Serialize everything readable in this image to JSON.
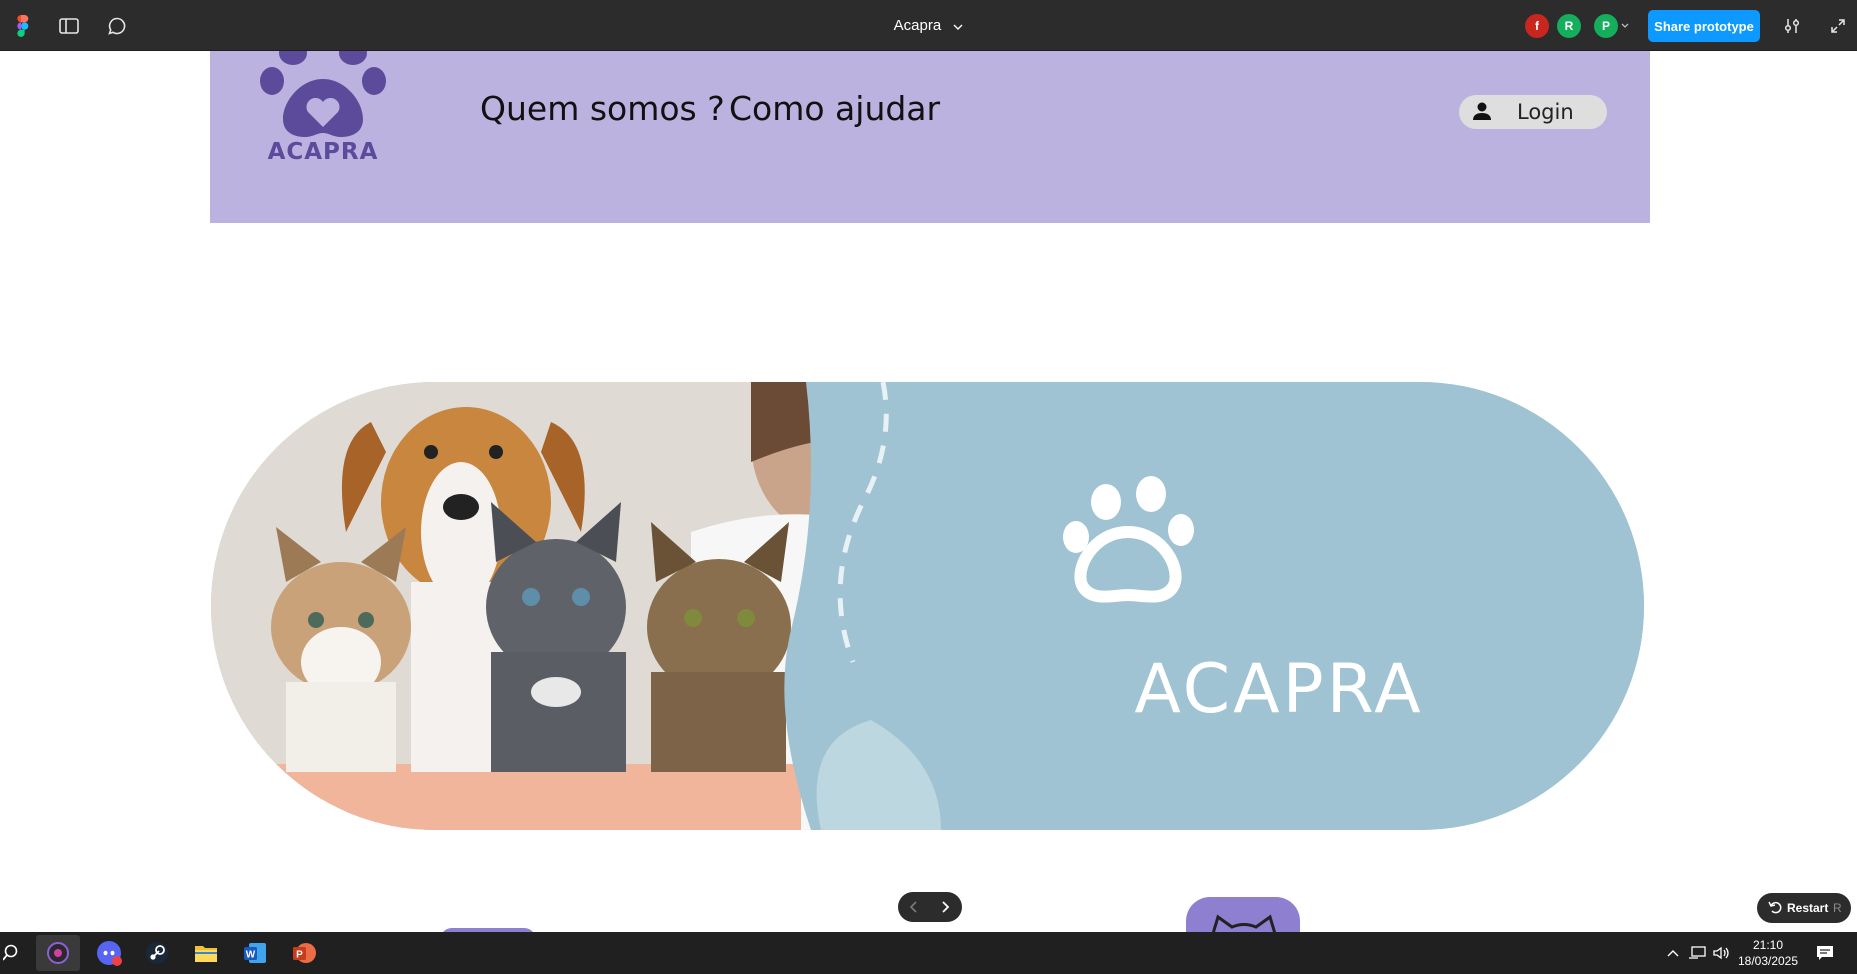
{
  "figma": {
    "document_title": "Acapra",
    "collaborators": [
      {
        "initial": "f",
        "color": "#c9261f"
      },
      {
        "initial": "R",
        "color": "#14ae5c"
      },
      {
        "initial": "P",
        "color": "#14ae5c"
      }
    ],
    "share_label": "Share prototype",
    "restart_label": "Restart",
    "restart_shortcut": "R",
    "accent_color": "#0d99ff"
  },
  "site": {
    "logo_text": "ACAPRA",
    "nav": [
      {
        "label": "Quem somos ?"
      },
      {
        "label": "Como ajudar"
      }
    ],
    "login_label": "Login",
    "header_color": "#bbb2e0",
    "brand_color": "#5b4b9a",
    "banner": {
      "brand_text": "ACAPRA",
      "background_color": "#9fc3d2"
    }
  },
  "taskbar": {
    "apps": [
      "search-icon",
      "obs-icon",
      "discord-icon",
      "steam-icon",
      "file-explorer-icon",
      "word-icon",
      "powerpoint-icon"
    ],
    "time": "21:10",
    "date": "18/03/2025"
  }
}
